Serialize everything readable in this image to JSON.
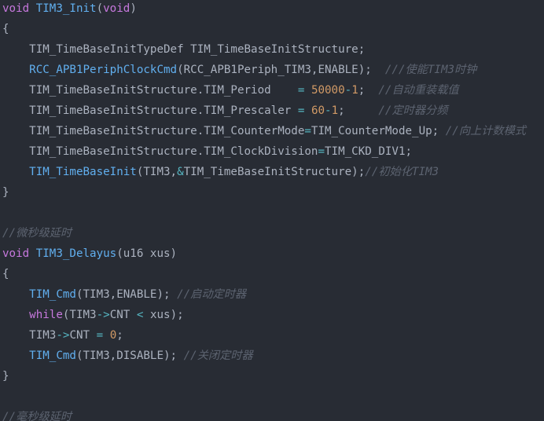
{
  "lines": [
    [
      {
        "t": "void",
        "c": "kw"
      },
      {
        "t": " "
      },
      {
        "t": "TIM3_Init",
        "c": "fn"
      },
      {
        "t": "("
      },
      {
        "t": "void",
        "c": "kw"
      },
      {
        "t": ")"
      }
    ],
    [
      {
        "t": "{"
      }
    ],
    [
      {
        "t": "    TIM_TimeBaseInitTypeDef TIM_TimeBaseInitStructure;"
      }
    ],
    [
      {
        "t": "    "
      },
      {
        "t": "RCC_APB1PeriphClockCmd",
        "c": "fn"
      },
      {
        "t": "(RCC_APB1Periph_TIM3,ENABLE);  "
      },
      {
        "t": "///使能TIM3时钟",
        "c": "cm"
      }
    ],
    [
      {
        "t": "    TIM_TimeBaseInitStructure.TIM_Period    "
      },
      {
        "t": "=",
        "c": "op"
      },
      {
        "t": " "
      },
      {
        "t": "50000",
        "c": "num"
      },
      {
        "t": "-",
        "c": "op"
      },
      {
        "t": "1",
        "c": "num"
      },
      {
        "t": ";  "
      },
      {
        "t": "//自动重装载值",
        "c": "cm"
      }
    ],
    [
      {
        "t": "    TIM_TimeBaseInitStructure.TIM_Prescaler "
      },
      {
        "t": "=",
        "c": "op"
      },
      {
        "t": " "
      },
      {
        "t": "60",
        "c": "num"
      },
      {
        "t": "-",
        "c": "op"
      },
      {
        "t": "1",
        "c": "num"
      },
      {
        "t": ";     "
      },
      {
        "t": "//定时器分频",
        "c": "cm"
      }
    ],
    [
      {
        "t": "    TIM_TimeBaseInitStructure.TIM_CounterMode"
      },
      {
        "t": "=",
        "c": "op"
      },
      {
        "t": "TIM_CounterMode_Up; "
      },
      {
        "t": "//向上计数模式",
        "c": "cm"
      }
    ],
    [
      {
        "t": "    TIM_TimeBaseInitStructure.TIM_ClockDivision"
      },
      {
        "t": "=",
        "c": "op"
      },
      {
        "t": "TIM_CKD_DIV1;"
      }
    ],
    [
      {
        "t": "    "
      },
      {
        "t": "TIM_TimeBaseInit",
        "c": "fn"
      },
      {
        "t": "(TIM3,"
      },
      {
        "t": "&",
        "c": "op"
      },
      {
        "t": "TIM_TimeBaseInitStructure);"
      },
      {
        "t": "//初始化TIM3",
        "c": "cm"
      }
    ],
    [
      {
        "t": "}"
      }
    ],
    [
      {
        "t": ""
      }
    ],
    [
      {
        "t": "//微秒级延时",
        "c": "cm"
      }
    ],
    [
      {
        "t": "void",
        "c": "kw"
      },
      {
        "t": " "
      },
      {
        "t": "TIM3_Delayus",
        "c": "fn"
      },
      {
        "t": "(u16 xus)"
      }
    ],
    [
      {
        "t": "{"
      }
    ],
    [
      {
        "t": "    "
      },
      {
        "t": "TIM_Cmd",
        "c": "fn"
      },
      {
        "t": "(TIM3,ENABLE); "
      },
      {
        "t": "//启动定时器",
        "c": "cm"
      }
    ],
    [
      {
        "t": "    "
      },
      {
        "t": "while",
        "c": "kw"
      },
      {
        "t": "(TIM3"
      },
      {
        "t": "->",
        "c": "op"
      },
      {
        "t": "CNT "
      },
      {
        "t": "<",
        "c": "op"
      },
      {
        "t": " xus);"
      }
    ],
    [
      {
        "t": "    TIM3"
      },
      {
        "t": "->",
        "c": "op"
      },
      {
        "t": "CNT "
      },
      {
        "t": "=",
        "c": "op"
      },
      {
        "t": " "
      },
      {
        "t": "0",
        "c": "num"
      },
      {
        "t": ";"
      }
    ],
    [
      {
        "t": "    "
      },
      {
        "t": "TIM_Cmd",
        "c": "fn"
      },
      {
        "t": "(TIM3,DISABLE); "
      },
      {
        "t": "//关闭定时器",
        "c": "cm"
      }
    ],
    [
      {
        "t": "}"
      }
    ],
    [
      {
        "t": ""
      }
    ],
    [
      {
        "t": "//毫秒级延时",
        "c": "cm"
      }
    ]
  ]
}
